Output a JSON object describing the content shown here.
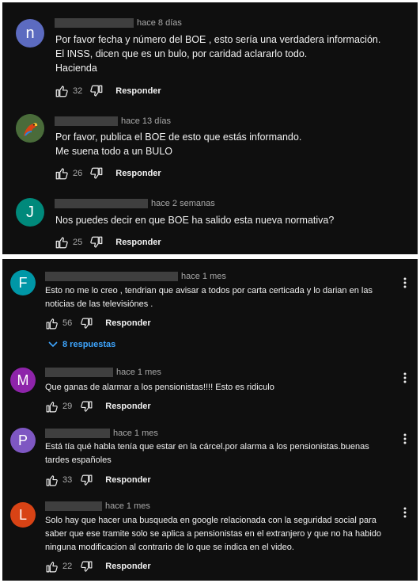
{
  "labels": {
    "reply": "Responder"
  },
  "panel1": {
    "comments": [
      {
        "avatar_letter": "n",
        "avatar_color": "#5c6bc0",
        "time": "hace 8 días",
        "lines": [
          "Por favor fecha y número del BOE , esto sería una verdadera información.",
          "El INSS, dicen que es un bulo, por caridad aclararlo todo.",
          "Hacienda"
        ],
        "likes": "32"
      },
      {
        "avatar_letter": "",
        "avatar_color": "#2e7d32",
        "time": "hace 13 días",
        "lines": [
          "Por favor, publica el BOE de esto que estás informando.",
          "Me suena todo a un BULO"
        ],
        "likes": "26"
      },
      {
        "avatar_letter": "J",
        "avatar_color": "#00897b",
        "time": "hace 2 semanas",
        "lines": [
          "Nos puedes decir en que BOE ha salido esta nueva normativa?"
        ],
        "likes": "25"
      }
    ]
  },
  "panel2": {
    "comments": [
      {
        "avatar_letter": "F",
        "avatar_color": "#0097a7",
        "time": "hace 1 mes",
        "lines": [
          "Esto no me lo creo , tendrian que avisar a todos por carta certicada y lo darian en las",
          "noticias de las televisiónes ."
        ],
        "likes": "56",
        "replies": "8 respuestas"
      },
      {
        "avatar_letter": "M",
        "avatar_color": "#8e24aa",
        "time": "hace 1 mes",
        "lines": [
          "Que ganas de alarmar a los pensionistas!!!! Esto es ridiculo"
        ],
        "likes": "29"
      },
      {
        "avatar_letter": "P",
        "avatar_color": "#7e57c2",
        "time": "hace 1 mes",
        "lines": [
          "Está tía qué habla tenía que estar en la cárcel.por alarma a los pensionistas.buenas",
          "tardes españoles"
        ],
        "likes": "33"
      },
      {
        "avatar_letter": "L",
        "avatar_color": "#d84315",
        "time": "hace 1 mes",
        "lines": [
          "Solo hay que hacer una busqueda en google relacionada con la seguridad social para",
          "saber que ese tramite solo se aplica a pensionistas en el extranjero y que no ha habido",
          "ninguna modificacion al contrario de lo que se indica en el video."
        ],
        "likes": "22"
      }
    ]
  }
}
